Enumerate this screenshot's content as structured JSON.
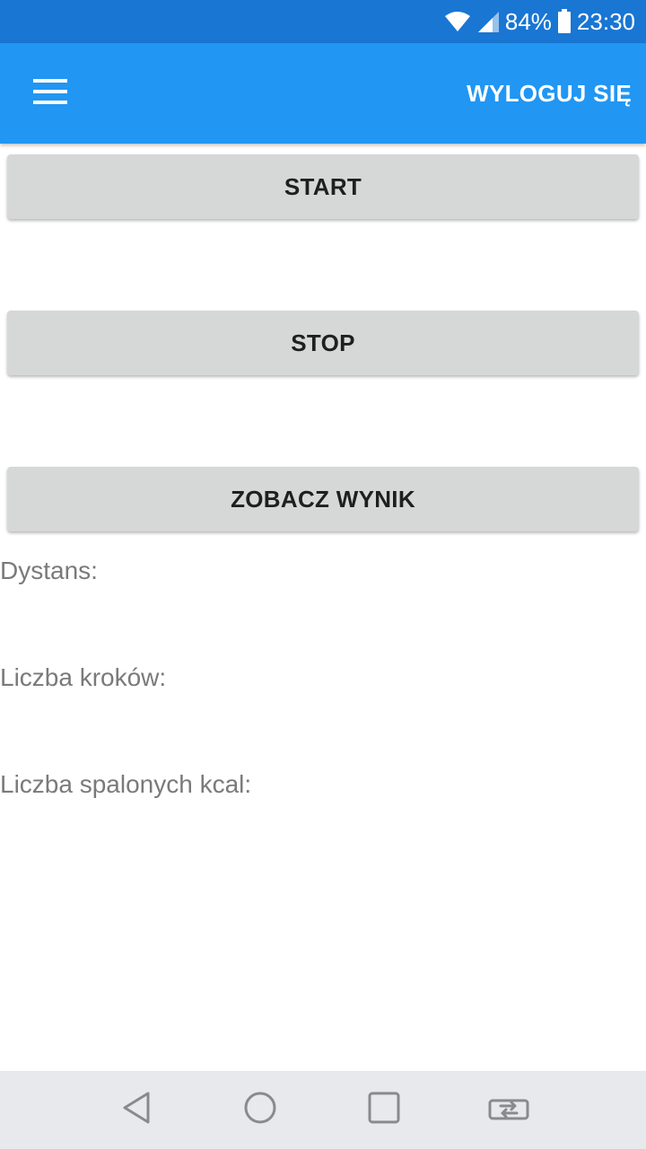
{
  "status_bar": {
    "battery_percent": "84%",
    "time": "23:30",
    "icons": [
      "wifi-icon",
      "signal-icon",
      "battery-icon"
    ]
  },
  "toolbar": {
    "menu_icon": "hamburger-menu-icon",
    "logout_label": "WYLOGUJ SIĘ"
  },
  "actions": {
    "start_label": "START",
    "stop_label": "STOP",
    "result_label": "ZOBACZ WYNIK"
  },
  "stats": {
    "distance_label": "Dystans:",
    "steps_label": "Liczba kroków:",
    "kcal_label": "Liczba spalonych kcal:"
  },
  "nav_bar": {
    "icons": [
      "back-icon",
      "home-icon",
      "recent-apps-icon",
      "switch-apps-icon"
    ]
  },
  "colors": {
    "status_bar": "#1976d2",
    "toolbar": "#2196f3",
    "button": "#d6d7d7",
    "label_text": "#7a7a7a",
    "nav_bar": "#e8e9ec"
  }
}
